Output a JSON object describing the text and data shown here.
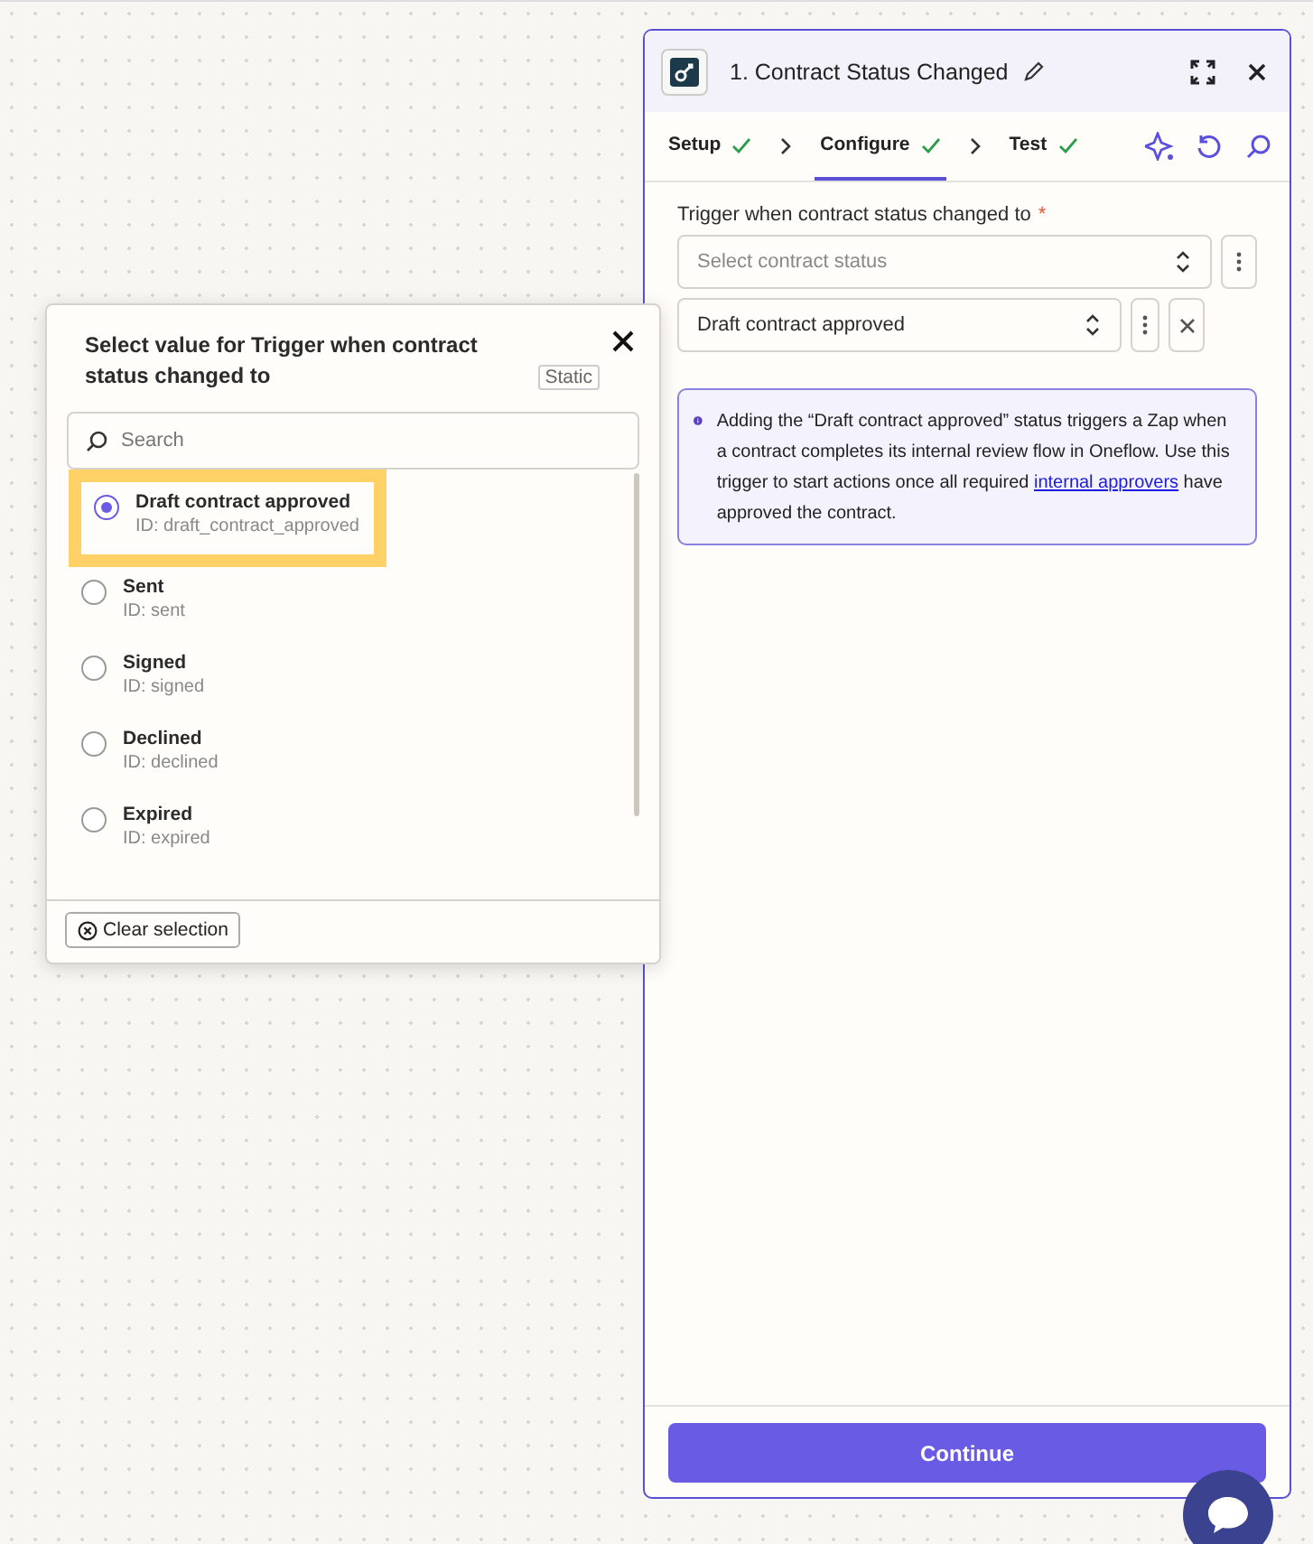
{
  "panel": {
    "title": "1. Contract Status Changed",
    "steps": [
      {
        "label": "Setup",
        "done": true,
        "selected": false
      },
      {
        "label": "Configure",
        "done": true,
        "selected": true
      },
      {
        "label": "Test",
        "done": true,
        "selected": false
      }
    ],
    "field": {
      "label": "Trigger when contract status changed to",
      "required": true,
      "required_mark": "*",
      "placeholder": "Select contract status",
      "values": [
        "Draft contract approved"
      ]
    },
    "info": {
      "before": "Adding the “Draft contract approved” status triggers a Zap when a contract completes its internal review flow in Oneflow. Use this trigger to start actions once all required ",
      "link": "internal approvers",
      "after": " have approved the contract."
    },
    "continue_button": "Continue"
  },
  "popup": {
    "title": "Select value for Trigger when contract status changed to",
    "badge": "Static",
    "search": {
      "placeholder": "Search"
    },
    "options": [
      {
        "label": "Draft contract approved",
        "id": "ID: draft_contract_approved",
        "selected": true,
        "highlighted": true
      },
      {
        "label": "Sent",
        "id": "ID: sent",
        "selected": false,
        "highlighted": false
      },
      {
        "label": "Signed",
        "id": "ID: signed",
        "selected": false,
        "highlighted": false
      },
      {
        "label": "Declined",
        "id": "ID: declined",
        "selected": false,
        "highlighted": false
      },
      {
        "label": "Expired",
        "id": "ID: expired",
        "selected": false,
        "highlighted": false
      }
    ],
    "clear_button": "Clear selection"
  }
}
